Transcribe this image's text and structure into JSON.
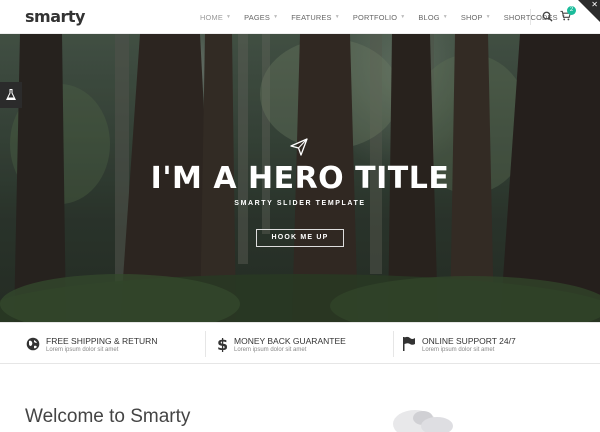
{
  "header": {
    "logo": "smarty",
    "nav": [
      "HOME",
      "PAGES",
      "FEATURES",
      "PORTFOLIO",
      "BLOG",
      "SHOP",
      "SHORTCODES"
    ],
    "cart_count": "2",
    "accent": "#1bbc9b"
  },
  "hero": {
    "title": "I'M A HERO TITLE",
    "subtitle": "SMARTY SLIDER TEMPLATE",
    "button": "HOOK ME UP",
    "icon": "paper-plane-icon"
  },
  "features": [
    {
      "icon": "globe-icon",
      "title": "FREE SHIPPING & RETURN",
      "desc": "Lorem ipsum dolor sit amet"
    },
    {
      "icon": "dollar-icon",
      "title": "MONEY BACK GUARANTEE",
      "desc": "Lorem ipsum dolor sit amet"
    },
    {
      "icon": "flag-icon",
      "title": "ONLINE SUPPORT 24/7",
      "desc": "Lorem ipsum dolor sit amet"
    }
  ],
  "welcome": {
    "title": "Welcome to Smarty"
  }
}
